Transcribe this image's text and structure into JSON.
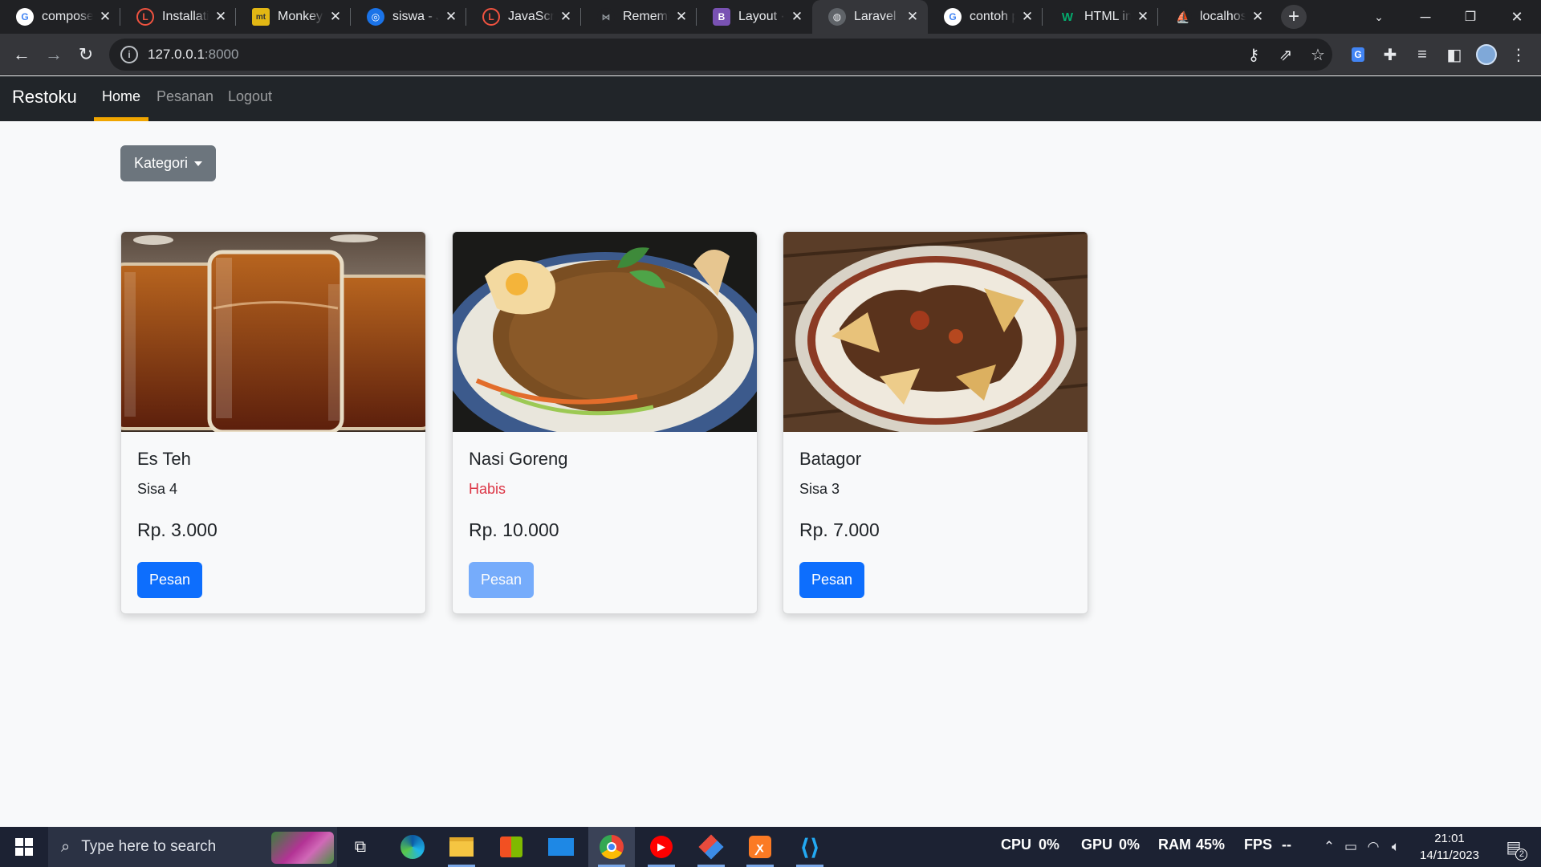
{
  "browser": {
    "tabs": [
      {
        "label": "compose",
        "icon": "google-icon"
      },
      {
        "label": "Installation",
        "icon": "laravel-icon"
      },
      {
        "label": "Monkeytype",
        "icon": "monkeytype-icon"
      },
      {
        "label": "siswa - Jupyter",
        "icon": "jupyter-icon"
      },
      {
        "label": "JavaScript",
        "icon": "laravel-icon"
      },
      {
        "label": "Remember",
        "icon": "remember-icon"
      },
      {
        "label": "Layout · Bootstrap",
        "icon": "bootstrap-icon"
      },
      {
        "label": "Laravel",
        "icon": "globe-icon"
      },
      {
        "label": "contoh project",
        "icon": "google-icon"
      },
      {
        "label": "HTML input",
        "icon": "w3schools-icon"
      },
      {
        "label": "localhost",
        "icon": "phpmyadmin-icon"
      }
    ],
    "active_tab": 7,
    "url_host": "127.0.0.1",
    "url_port": ":8000"
  },
  "site": {
    "brand": "Restoku",
    "nav": [
      {
        "label": "Home",
        "active": true
      },
      {
        "label": "Pesanan",
        "active": false
      },
      {
        "label": "Logout",
        "active": false
      }
    ],
    "accent_color": "#f0a500",
    "dropdown_label": "Kategori"
  },
  "menu": [
    {
      "name": "Es Teh",
      "stock": "Sisa 4",
      "price": "Rp. 3.000",
      "button": "Pesan",
      "available": true,
      "image": "iced-tea-glasses"
    },
    {
      "name": "Nasi Goreng",
      "stock": "Habis",
      "price": "Rp. 10.000",
      "button": "Pesan",
      "available": false,
      "image": "fried-rice-plate"
    },
    {
      "name": "Batagor",
      "stock": "Sisa 3",
      "price": "Rp. 7.000",
      "button": "Pesan",
      "available": true,
      "image": "batagor-plate"
    }
  ],
  "taskbar": {
    "search_placeholder": "Type here to search",
    "perf": {
      "cpu_label": "CPU",
      "cpu": "0%",
      "gpu_label": "GPU",
      "gpu": "0%",
      "ram_label": "RAM",
      "ram": "45%",
      "fps_label": "FPS",
      "fps": "--"
    },
    "time": "21:01",
    "date": "14/11/2023",
    "notification_count": "2"
  }
}
